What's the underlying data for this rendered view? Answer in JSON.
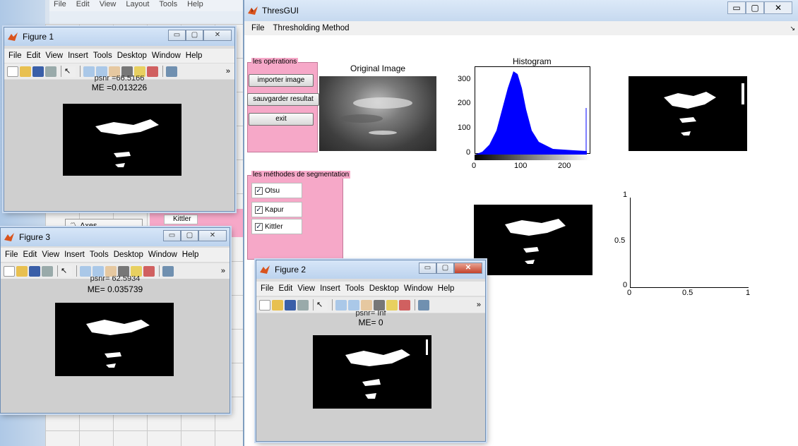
{
  "matlab_bg": {
    "menu": [
      "File",
      "Edit",
      "View",
      "Layout",
      "Tools",
      "Help"
    ],
    "axes_item": "Axes",
    "kittler_label": "Kittler"
  },
  "thresgui": {
    "title": "ThresGUI",
    "menu": [
      "File",
      "Thresholding Method"
    ],
    "menu_arrow": "↘",
    "operations_panel": {
      "title": "les opérations",
      "buttons": [
        "importer image",
        "sauvgarder resultat",
        "exit"
      ]
    },
    "segmentation_panel": {
      "title": "les méthodes de segmentation",
      "checks": [
        "Otsu",
        "Kapur",
        "Kittler"
      ]
    },
    "original_title": "Original Image",
    "histogram": {
      "title": "Histogram",
      "y_ticks": [
        "300",
        "200",
        "100",
        "0"
      ],
      "x_ticks": [
        "0",
        "100",
        "200"
      ]
    },
    "empty_axes": {
      "y_ticks": [
        "1",
        "0.5",
        "0"
      ],
      "x_ticks": [
        "0",
        "0.5",
        "1"
      ]
    }
  },
  "figure_menu": [
    "File",
    "Edit",
    "View",
    "Insert",
    "Tools",
    "Desktop",
    "Window",
    "Help"
  ],
  "figures": [
    {
      "title": "Figure 1",
      "line1": "psnr =66.5166",
      "line2": "ME =0.013226"
    },
    {
      "title": "Figure 3",
      "line1": "psnr= 62.5934",
      "line2": "ME= 0.035739"
    },
    {
      "title": "Figure 2",
      "line1": "psnr= Inf",
      "line2": "ME= 0"
    }
  ],
  "icons": [
    "new-icon",
    "open-icon",
    "save-icon",
    "print-icon",
    "pointer-icon",
    "zoom-in-icon",
    "zoom-out-icon",
    "pan-icon",
    "rotate-icon",
    "data-cursor-icon",
    "brush-icon",
    "link-icon"
  ],
  "colors": {
    "panel_pink": "#f6a8c8",
    "histogram_blue": "#0000ff",
    "titlebar": "#c8dcf2"
  }
}
